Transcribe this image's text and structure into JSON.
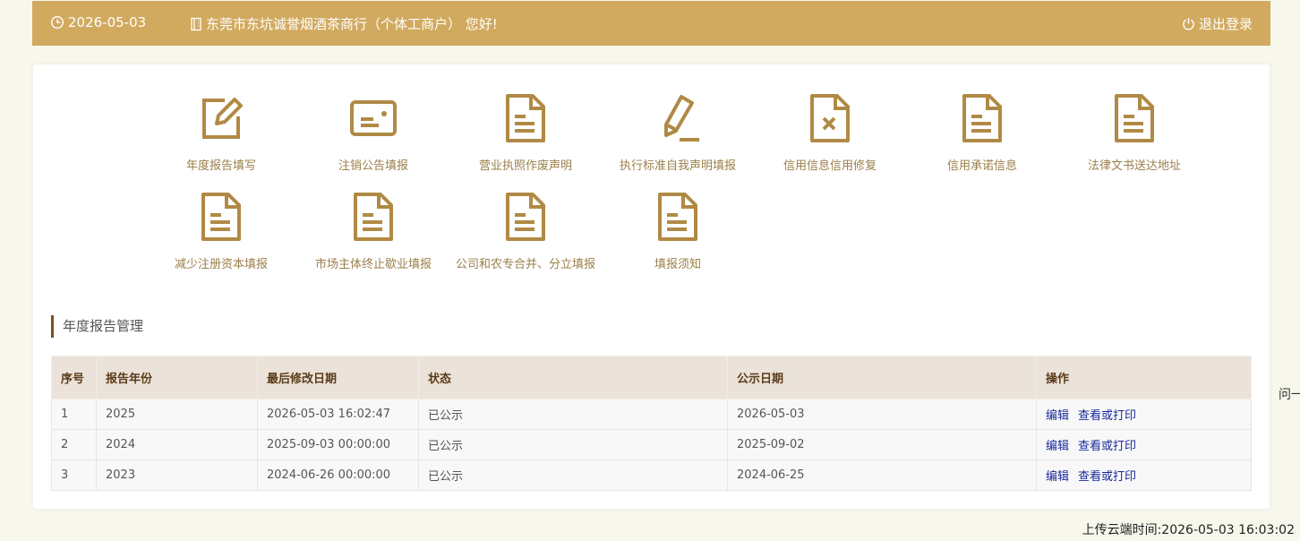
{
  "header": {
    "date": "2026-05-03",
    "greeting": "东莞市东坑诚誉烟酒茶商行（个体工商户） 您好!",
    "logout_label": "退出登录"
  },
  "menu": [
    {
      "label": "年度报告填写",
      "icon": "edit-icon"
    },
    {
      "label": "注销公告填报",
      "icon": "card-icon"
    },
    {
      "label": "营业执照作废声明",
      "icon": "document-icon"
    },
    {
      "label": "执行标准自我声明填报",
      "icon": "pencil-icon"
    },
    {
      "label": "信用信息信用修复",
      "icon": "document-x-icon"
    },
    {
      "label": "信用承诺信息",
      "icon": "document-icon"
    },
    {
      "label": "法律文书送达地址",
      "icon": "document-icon"
    },
    {
      "label": "减少注册资本填报",
      "icon": "document-icon"
    },
    {
      "label": "市场主体终止歇业填报",
      "icon": "document-icon"
    },
    {
      "label": "公司和农专合并、分立填报",
      "icon": "document-icon"
    },
    {
      "label": "填报须知",
      "icon": "document-icon"
    }
  ],
  "section": {
    "title": "年度报告管理"
  },
  "table": {
    "headers": [
      "序号",
      "报告年份",
      "最后修改日期",
      "状态",
      "公示日期",
      "操作"
    ],
    "rows": [
      {
        "no": "1",
        "year": "2025",
        "modified": "2026-05-03 16:02:47",
        "status": "已公示",
        "pub_date": "2026-05-03",
        "edit": "编辑",
        "view": "查看或打印"
      },
      {
        "no": "2",
        "year": "2024",
        "modified": "2025-09-03 00:00:00",
        "status": "已公示",
        "pub_date": "2025-09-02",
        "edit": "编辑",
        "view": "查看或打印"
      },
      {
        "no": "3",
        "year": "2023",
        "modified": "2024-06-26 00:00:00",
        "status": "已公示",
        "pub_date": "2024-06-25",
        "edit": "编辑",
        "view": "查看或打印"
      }
    ]
  },
  "side_text": "问一",
  "upload_time": "上传云端时间:2026-05-03 16:03:02",
  "colors": {
    "header_bg": "#d1aa5f",
    "icon": "#b08a45",
    "label": "#9a7f4a",
    "link": "#1a2a9a"
  }
}
